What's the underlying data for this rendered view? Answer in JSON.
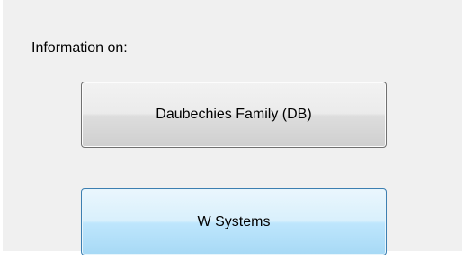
{
  "info": {
    "label": "Information on:"
  },
  "buttons": {
    "daubechies": "Daubechies Family (DB)",
    "w_systems": "W Systems"
  }
}
